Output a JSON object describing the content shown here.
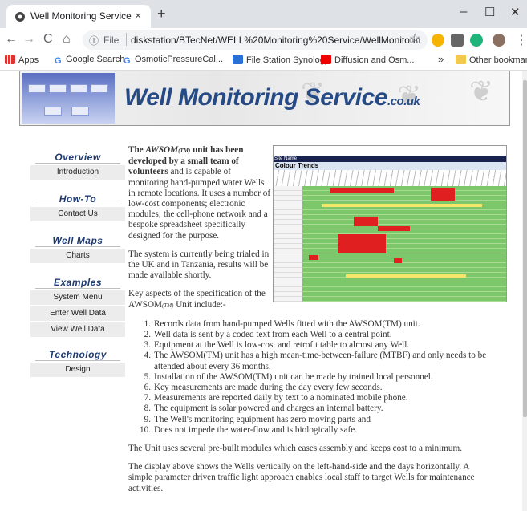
{
  "browser": {
    "tab_title": "Well Monitoring Service",
    "tab_close": "×",
    "new_tab": "+",
    "min": "–",
    "max": "☐",
    "close": "✕",
    "back": "←",
    "forward": "→",
    "reload": "C",
    "home": "⌂",
    "info": "ⓘ",
    "file_label": "File",
    "url": "diskstation/BTecNet/WELL%20Monitoring%20Service/WellMonitoringServi...",
    "star": "☆",
    "menu": "⋮"
  },
  "bookmarks": {
    "apps": "Apps",
    "items": [
      "Google Search",
      "OsmoticPressureCal...",
      "File Station Synology",
      "Diffusion and Osm..."
    ],
    "more": "»",
    "other": "Other bookmarks"
  },
  "banner": {
    "title": "Well Monitoring Service",
    "suffix": ".co.uk"
  },
  "sidebar": {
    "sections": [
      {
        "title": "Overview",
        "items": [
          "Introduction"
        ]
      },
      {
        "title": "How-To",
        "items": [
          "Contact Us"
        ]
      },
      {
        "title": "Well Maps",
        "items": [
          "Charts"
        ]
      },
      {
        "title": "Examples",
        "items": [
          "System Menu",
          "Enter Well Data",
          "View Well Data"
        ]
      },
      {
        "title": "Technology",
        "items": [
          "Design"
        ]
      }
    ]
  },
  "content": {
    "p1_bold_a": "The",
    "p1_em": "AWSOM",
    "p1_tm": "(TM)",
    "p1_bold_b": " unit has been developed by a small team of volunteers",
    "p1_rest": " and is capable of monitoring hand-pumped water Wells in remote locations. It uses a number of low-cost components; electronic modules; the cell-phone network and a bespoke spreadsheet specifically designed for the purpose.",
    "p2": "The system is currently being trialed in the UK and in Tanzania, results will be made available shortly.",
    "p3a": "Key aspects of the specification of the AWSOM",
    "p3tm": "(TM)",
    "p3b": " Unit include:-",
    "list": [
      "Records data from hand-pumped Wells fitted with the AWSOM(TM) unit.",
      "Well data is sent by a coded text from each Well to a central point.",
      "Equipment at the Well is low-cost and retrofit table to almost any Well.",
      "The AWSOM(TM) unit has a high mean-time-between-failure (MTBF) and only needs to be",
      "attended about every 36 months.",
      "Installation of the AWSOM(TM)  unit can be made by trained local personnel.",
      "Key measurements are made during the day every few seconds.",
      "Measurements are reported daily by text to a nominated mobile phone.",
      "The equipment is solar powered and charges an internal battery.",
      "The Well's monitoring equipment has zero moving parts and",
      "Does not impede the water-flow and is biologically safe."
    ],
    "list_nums": [
      "1.",
      "2.",
      "3.",
      "4.",
      "",
      "5.",
      "6.",
      "7.",
      "8.",
      "9.",
      "10."
    ],
    "p4": "The Unit uses several pre-built modules which eases assembly and keeps cost to a minimum.",
    "p5a": "The display above shows the Wells vertically on the left-hand-side and the days horizontally. A",
    "p5b": "simple parameter driven traffic light approach enables local staff to target Wells for maintenance",
    "p5c": "activities."
  },
  "thumbnail": {
    "title": "Colour Trends",
    "subtitle": "Site Name"
  }
}
